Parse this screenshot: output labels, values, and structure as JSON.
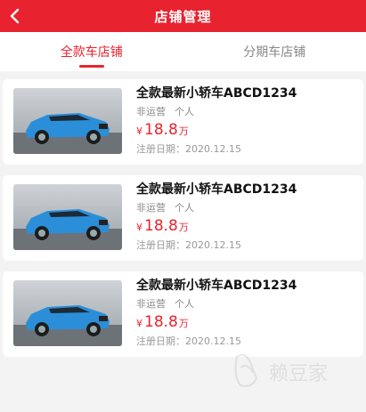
{
  "header": {
    "title": "店铺管理",
    "back_icon": "chevron-left-icon",
    "background_color": "#e8232f"
  },
  "tabs": [
    {
      "label": "全款车店铺",
      "active": true
    },
    {
      "label": "分期车店铺",
      "active": false
    }
  ],
  "accent_color": "#e8232f",
  "listings": [
    {
      "title": "全款最新小轿车ABCD1234",
      "tags": [
        "非运营",
        "个人"
      ],
      "currency": "¥",
      "price": "18.8",
      "price_unit": "万",
      "registration": "注册日期：2020.12.15",
      "image": "blue-suv-photo"
    },
    {
      "title": "全款最新小轿车ABCD1234",
      "tags": [
        "非运营",
        "个人"
      ],
      "currency": "¥",
      "price": "18.8",
      "price_unit": "万",
      "registration": "注册日期：2020.12.15",
      "image": "blue-suv-photo"
    },
    {
      "title": "全款最新小轿车ABCD1234",
      "tags": [
        "非运营",
        "个人"
      ],
      "currency": "¥",
      "price": "18.8",
      "price_unit": "万",
      "registration": "注册日期：2020.12.15",
      "image": "blue-suv-photo"
    }
  ],
  "watermark": {
    "text": "赖豆家"
  }
}
